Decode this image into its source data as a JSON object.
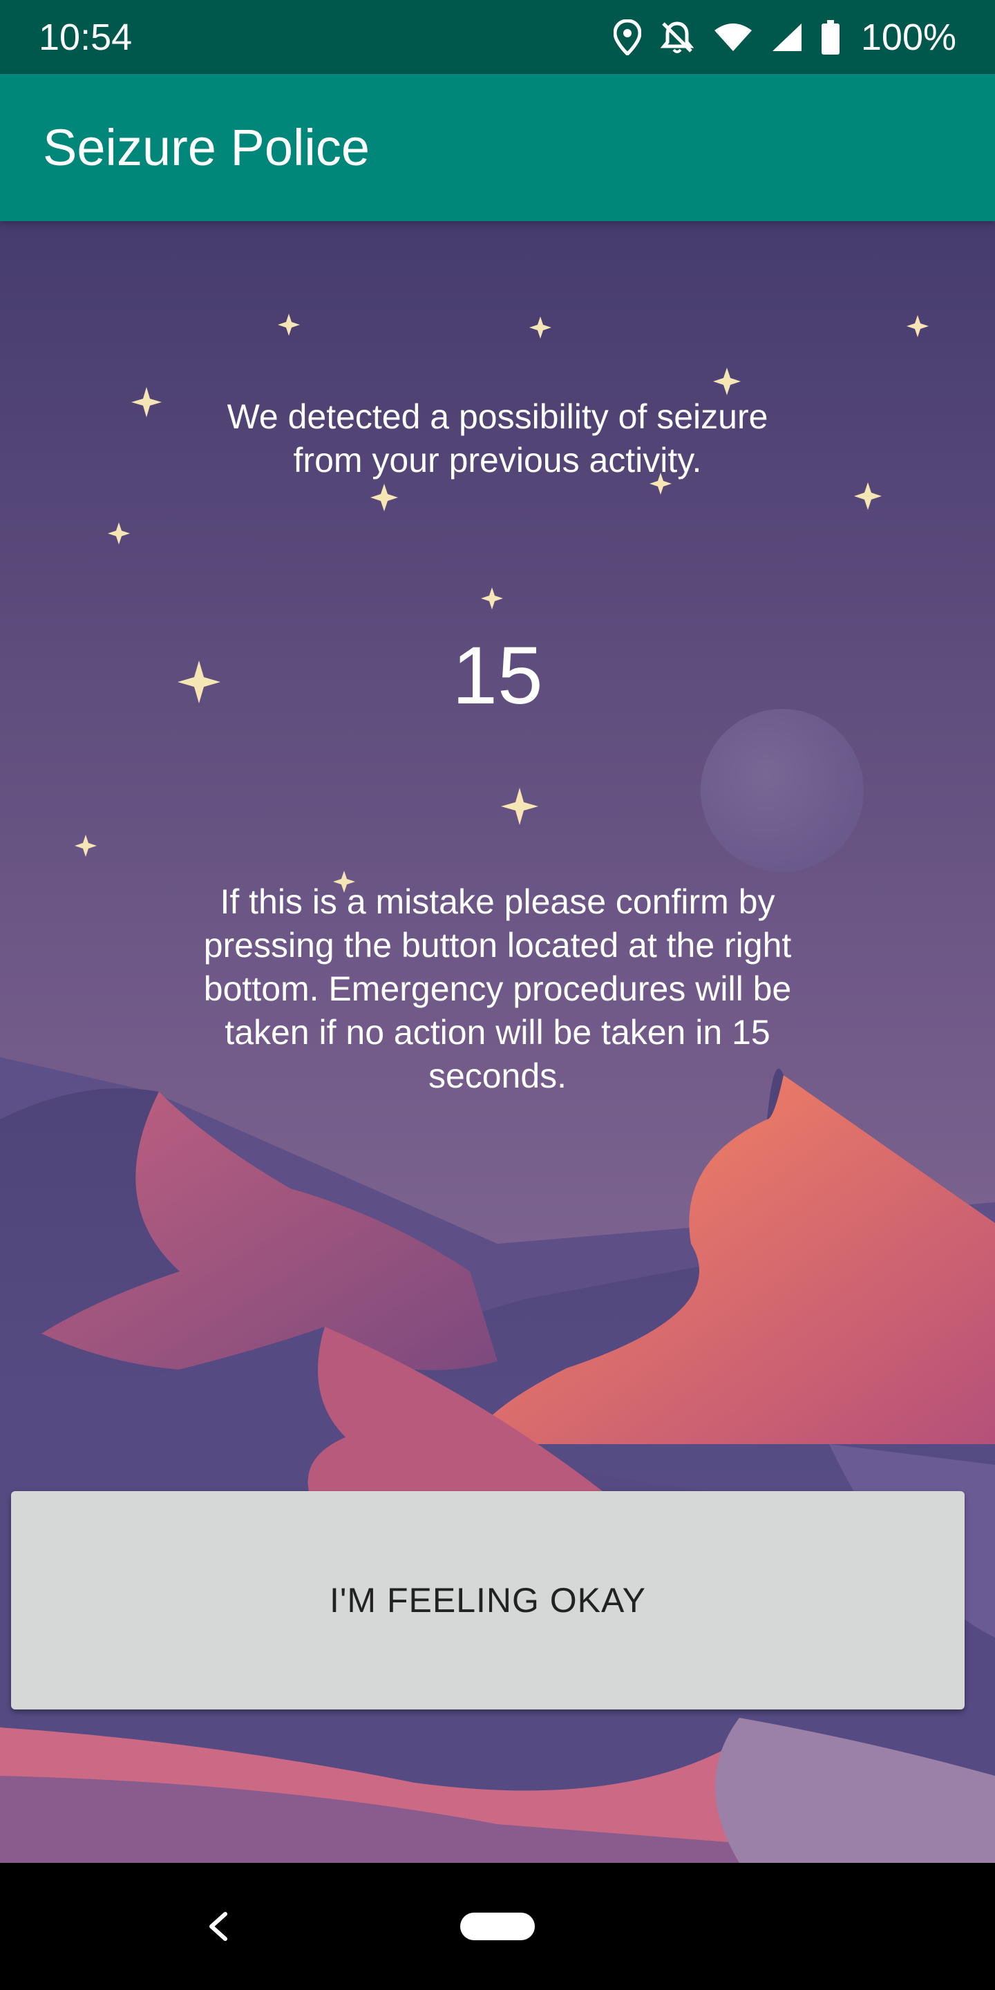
{
  "status_bar": {
    "time": "10:54",
    "battery": "100%",
    "icons": [
      "location-icon",
      "notifications-off-icon",
      "wifi-icon",
      "signal-icon",
      "battery-icon"
    ]
  },
  "app_bar": {
    "title": "Seizure Police"
  },
  "main": {
    "detected_message": "We detected a possibility of seizure from your previous activity.",
    "countdown": "15",
    "instructions": "If this is a mistake please confirm by pressing the button located at the right bottom. Emergency procedures will be taken if no action will be taken in 15 seconds.",
    "ok_button_label": "I'M FEELING OKAY"
  },
  "nav_bar": {
    "icons": [
      "back-icon",
      "home-pill-icon"
    ]
  },
  "colors": {
    "status_bar": "#00574b",
    "app_bar": "#00877a",
    "sky_top": "#463c6e",
    "sky_bottom": "#9a7ba0",
    "button": "#d6d7d7"
  }
}
